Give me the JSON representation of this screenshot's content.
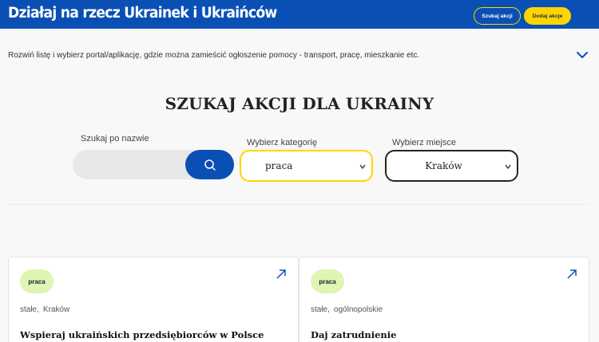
{
  "header": {
    "title": "Działaj na rzecz Ukrainek i Ukraińców",
    "search_button": "Szukaj akcji",
    "add_button": "Dodaj akcje"
  },
  "expander": {
    "text": "Rozwiń listę i wybierz portal/aplikację, gdzie można zamieścić ogłoszenie pomocy - transport, pracę, mieszkanie etc."
  },
  "search_section": {
    "heading": "SZUKAJ AKCJI DLA UKRAINY",
    "name_label": "Szukaj po nazwie",
    "name_value": "",
    "category_label": "Wybierz kategorię",
    "category_value": "praca",
    "place_label": "Wybierz miejsce",
    "place_value": "Kraków"
  },
  "colors": {
    "primary": "#0a50b4",
    "accent": "#ffd500",
    "badge": "#dff5b4"
  },
  "cards": [
    {
      "badge": "praca",
      "type": "stałe,",
      "location": "Kraków",
      "title": "Wspieraj ukraińskich przedsiębiorców w Polsce"
    },
    {
      "badge": "praca",
      "type": "stałe,",
      "location": "ogólnopolskie",
      "title": "Daj zatrudnienie"
    }
  ]
}
